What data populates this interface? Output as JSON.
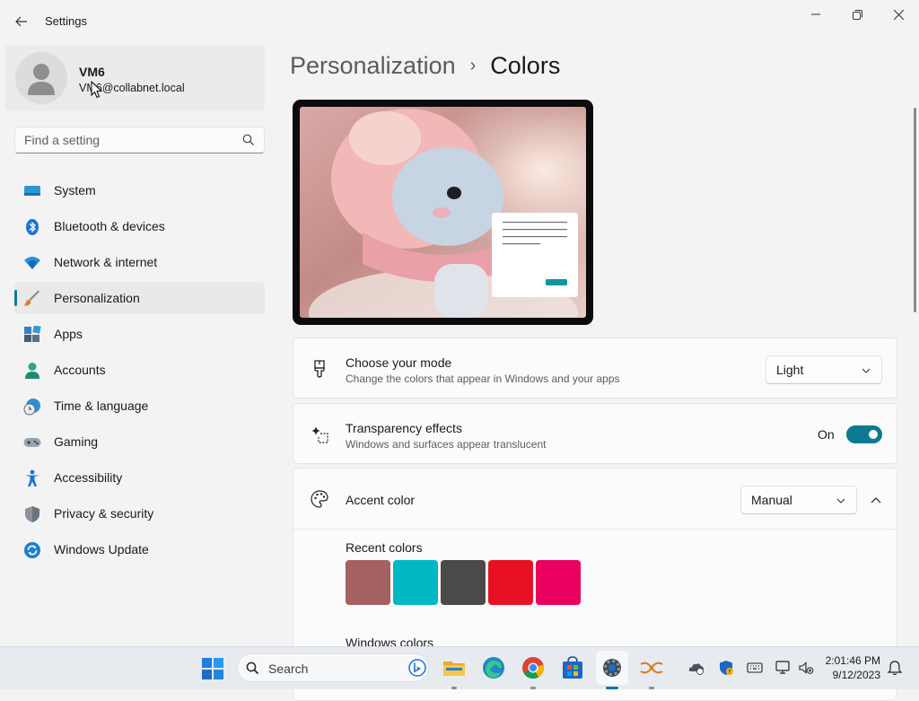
{
  "window": {
    "app_title": "Settings",
    "back_icon": "arrow-left-icon",
    "controls": [
      "minimize-icon",
      "restore-icon",
      "close-icon"
    ]
  },
  "profile": {
    "name": "VM6",
    "email": "VM6@collabnet.local"
  },
  "search": {
    "placeholder": "Find a setting",
    "value": ""
  },
  "sidebar": {
    "items": [
      {
        "label": "System",
        "icon": "system-monitor-icon"
      },
      {
        "label": "Bluetooth & devices",
        "icon": "bluetooth-icon"
      },
      {
        "label": "Network & internet",
        "icon": "wifi-icon"
      },
      {
        "label": "Personalization",
        "icon": "paintbrush-icon",
        "selected": true
      },
      {
        "label": "Apps",
        "icon": "apps-icon"
      },
      {
        "label": "Accounts",
        "icon": "accounts-icon"
      },
      {
        "label": "Time & language",
        "icon": "time-language-icon"
      },
      {
        "label": "Gaming",
        "icon": "gamepad-icon"
      },
      {
        "label": "Accessibility",
        "icon": "accessibility-icon"
      },
      {
        "label": "Privacy & security",
        "icon": "shield-icon"
      },
      {
        "label": "Windows Update",
        "icon": "windows-update-icon"
      }
    ]
  },
  "breadcrumb": {
    "parent": "Personalization",
    "separator": "›",
    "current": "Colors"
  },
  "mode_card": {
    "title": "Choose your mode",
    "subtitle": "Change the colors that appear in Windows and your apps",
    "value": "Light"
  },
  "transparency_card": {
    "title": "Transparency effects",
    "subtitle": "Windows and surfaces appear translucent",
    "state_label": "On",
    "enabled": true
  },
  "accent_card": {
    "title": "Accent color",
    "value": "Manual",
    "recent_label": "Recent colors",
    "recent_colors": [
      "#a36162",
      "#00b7c3",
      "#4c4a48",
      "#e81123",
      "#ea005e"
    ],
    "windows_label": "Windows colors"
  },
  "colors": {
    "accent": "#0e7a92",
    "background": "#f3f3f3",
    "card": "#fbfbfb"
  },
  "taskbar": {
    "search_label": "Search",
    "apps": [
      "start-icon",
      "search-icon",
      "file-explorer-icon",
      "edge-icon",
      "chrome-icon",
      "store-icon",
      "settings-icon",
      "network-app-icon"
    ],
    "time": "2:01:46 PM",
    "date": "9/12/2023"
  }
}
